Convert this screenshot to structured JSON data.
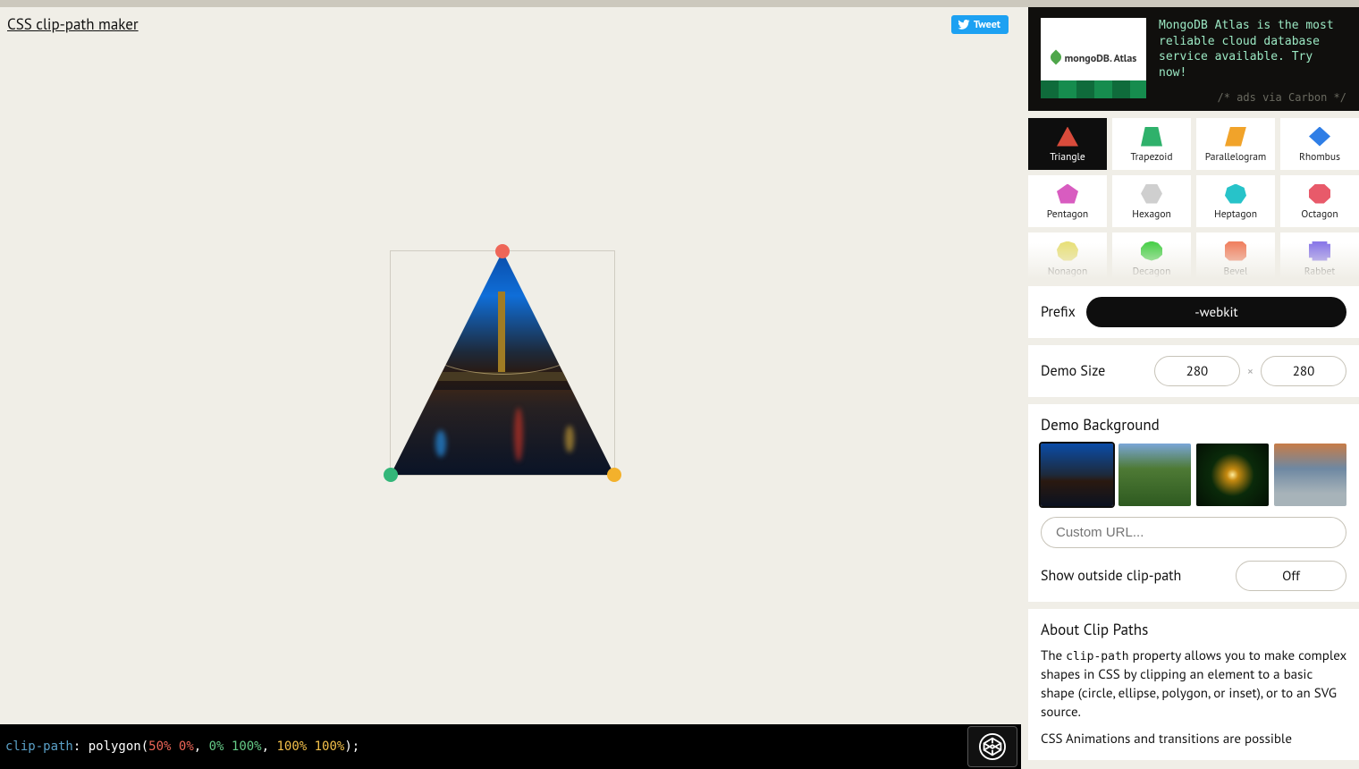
{
  "header": {
    "title": "CSS clip-path maker",
    "tweet_label": "Tweet"
  },
  "ad": {
    "logo_text": "mongoDB. Atlas",
    "text": "MongoDB Atlas is the most reliable cloud database service available. Try now!",
    "via": "/* ads via Carbon */"
  },
  "shapes": [
    {
      "label": "Triangle",
      "color": "#d94b3b",
      "clip": "polygon(50% 0%,0% 100%,100% 100%)",
      "sel": true
    },
    {
      "label": "Trapezoid",
      "color": "#2fb16b",
      "clip": "polygon(20% 0%,80% 0%,100% 100%,0% 100%)"
    },
    {
      "label": "Parallelogram",
      "color": "#f1a32a",
      "clip": "polygon(25% 0%,100% 0%,75% 100%,0% 100%)"
    },
    {
      "label": "Rhombus",
      "color": "#2f7ee6",
      "clip": "polygon(50% 0%,100% 50%,50% 100%,0% 50%)"
    },
    {
      "label": "Pentagon",
      "color": "#d85cc0",
      "clip": "polygon(50% 0%,100% 38%,82% 100%,18% 100%,0% 38%)"
    },
    {
      "label": "Hexagon",
      "color": "#cfcfcf",
      "clip": "polygon(25% 0%,75% 0%,100% 50%,75% 100%,25% 100%,0% 50%)"
    },
    {
      "label": "Heptagon",
      "color": "#27c3c9",
      "clip": "polygon(50% 0%,90% 20%,100% 60%,75% 100%,25% 100%,0% 60%,10% 20%)"
    },
    {
      "label": "Octagon",
      "color": "#e85a6a",
      "clip": "polygon(30% 0%,70% 0%,100% 30%,100% 70%,70% 100%,30% 100%,0% 70%,0% 30%)"
    },
    {
      "label": "Nonagon",
      "color": "#e8e07a",
      "clip": "polygon(50% 0%,83% 12%,100% 43%,94% 78%,68% 100%,32% 100%,6% 78%,0% 43%,17% 12%)"
    },
    {
      "label": "Decagon",
      "color": "#4bd04b",
      "clip": "polygon(50% 0%,80% 10%,100% 35%,100% 70%,80% 90%,50% 100%,20% 90%,0% 70%,0% 35%,20% 10%)"
    },
    {
      "label": "Bevel",
      "color": "#f08262",
      "clip": "polygon(20% 0%,80% 0%,100% 20%,100% 80%,80% 100%,20% 100%,0% 80%,0% 20%)"
    },
    {
      "label": "Rabbet",
      "color": "#8a79e8",
      "clip": "polygon(0% 15%,15% 15%,15% 0%,85% 0%,85% 15%,100% 15%,100% 85%,85% 85%,85% 100%,15% 100%,15% 85%,0% 85%)"
    }
  ],
  "prefix": {
    "label": "Prefix",
    "value": "-webkit"
  },
  "demo_size": {
    "label": "Demo Size",
    "w": "280",
    "h": "280",
    "mult": "×"
  },
  "bg": {
    "heading": "Demo Background",
    "custom_placeholder": "Custom URL...",
    "outside_label": "Show outside clip-path",
    "outside_value": "Off"
  },
  "about": {
    "heading": "About Clip Paths",
    "p1a": "The ",
    "p1_code": "clip-path",
    "p1b": " property allows you to make complex shapes in CSS by clipping an element to a basic shape (circle, ellipse, polygon, or inset), or to an SVG source.",
    "p2": "CSS Animations and transitions are possible"
  },
  "code": {
    "prop": "clip-path",
    "fn": "polygon",
    "c1": "50% 0%",
    "c2": "0% 100%",
    "c3": "100% 100%"
  }
}
